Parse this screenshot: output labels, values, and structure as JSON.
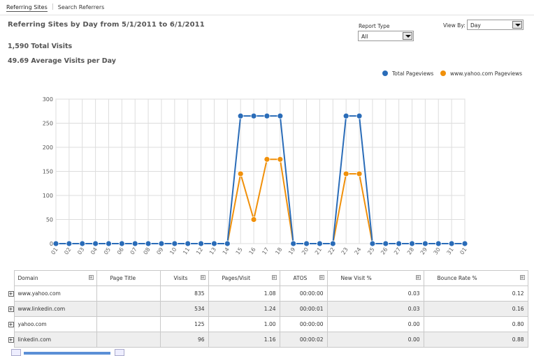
{
  "tabs": [
    {
      "label": "Referring Sites",
      "active": true
    },
    {
      "label": "Search Referrers",
      "active": false
    }
  ],
  "report": {
    "title": "Referring Sites by Day from 5/1/2011 to 6/1/2011",
    "total_visits": "1,590 Total Visits",
    "avg_visits": "49.69 Average Visits per Day"
  },
  "controls": {
    "report_type_label": "Report Type",
    "report_type_value": "All",
    "view_by_label": "View By:",
    "view_by_value": "Day"
  },
  "colors": {
    "total": "#2a6cb8",
    "yahoo": "#f0900a",
    "grid": "#dddddd"
  },
  "chart_data": {
    "type": "line",
    "categories": [
      "01",
      "02",
      "03",
      "04",
      "05",
      "06",
      "07",
      "08",
      "09",
      "10",
      "11",
      "12",
      "13",
      "14",
      "15",
      "16",
      "17",
      "18",
      "19",
      "20",
      "21",
      "22",
      "23",
      "24",
      "25",
      "26",
      "27",
      "28",
      "29",
      "30",
      "31",
      "01"
    ],
    "ylim": [
      0,
      300
    ],
    "yticks": [
      "0",
      "50",
      "100",
      "150",
      "200",
      "250",
      "300"
    ],
    "series": [
      {
        "name": "Total Pageviews",
        "color": "#2a6cb8",
        "values": [
          0,
          0,
          0,
          0,
          0,
          0,
          0,
          0,
          0,
          0,
          0,
          0,
          0,
          0,
          265,
          265,
          265,
          265,
          0,
          0,
          0,
          0,
          265,
          265,
          0,
          0,
          0,
          0,
          0,
          0,
          0,
          0
        ]
      },
      {
        "name": "www.yahoo.com Pageviews",
        "color": "#f0900a",
        "values": [
          0,
          0,
          0,
          0,
          0,
          0,
          0,
          0,
          0,
          0,
          0,
          0,
          0,
          0,
          145,
          50,
          175,
          175,
          0,
          0,
          0,
          0,
          145,
          145,
          0,
          0,
          0,
          0,
          0,
          0,
          0,
          0
        ]
      }
    ],
    "legend_position": "top-right",
    "grid": true
  },
  "table": {
    "columns": [
      "Domain",
      "Page Title",
      "Visits",
      "Pages/Visit",
      "ATOS",
      "New Visit %",
      "Bounce Rate %"
    ],
    "sort_icon": "⊞",
    "expand_icon": "+",
    "rows": [
      {
        "domain": "www.yahoo.com",
        "page_title": "",
        "visits": "835",
        "pages": "1.08",
        "atos": "00:00:00",
        "new": "0.03",
        "bounce": "0.12"
      },
      {
        "domain": "www.linkedin.com",
        "page_title": "",
        "visits": "534",
        "pages": "1.24",
        "atos": "00:00:01",
        "new": "0.03",
        "bounce": "0.16"
      },
      {
        "domain": "yahoo.com",
        "page_title": "",
        "visits": "125",
        "pages": "1.00",
        "atos": "00:00:00",
        "new": "0.00",
        "bounce": "0.80"
      },
      {
        "domain": "linkedin.com",
        "page_title": "",
        "visits": "96",
        "pages": "1.16",
        "atos": "00:00:02",
        "new": "0.00",
        "bounce": "0.88"
      }
    ]
  }
}
